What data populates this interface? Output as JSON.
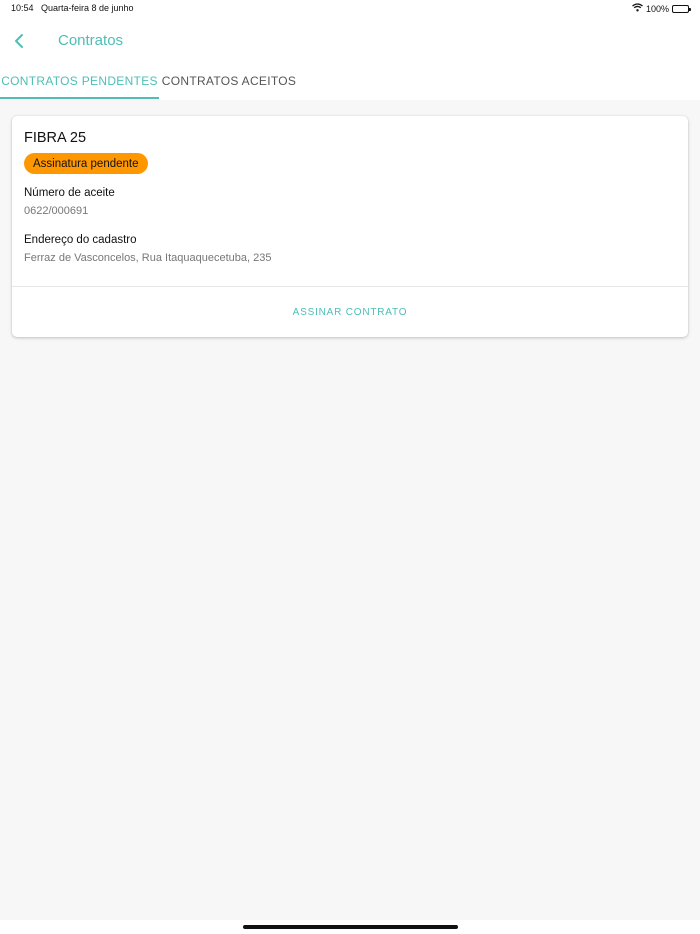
{
  "status_bar": {
    "time": "10:54",
    "date": "Quarta-feira 8 de junho",
    "battery": "100%"
  },
  "header": {
    "title": "Contratos"
  },
  "tabs": [
    {
      "label": "CONTRATOS PENDENTES",
      "active": true
    },
    {
      "label": "CONTRATOS ACEITOS",
      "active": false
    }
  ],
  "contract": {
    "plan_name": "FIBRA 25",
    "status": "Assinatura pendente",
    "acceptance_label": "Número de aceite",
    "acceptance_value": "0622/000691",
    "address_label": "Endereço do cadastro",
    "address_value": "Ferraz de Vasconcelos, Rua Itaquaquecetuba, 235",
    "action_label": "ASSINAR CONTRATO"
  },
  "colors": {
    "accent": "#4dbfb5",
    "status_pending": "#ff9800",
    "background": "#f7f7f7"
  },
  "icons": {
    "back": "chevron-left-icon",
    "wifi": "wifi-icon",
    "battery": "battery-icon"
  }
}
